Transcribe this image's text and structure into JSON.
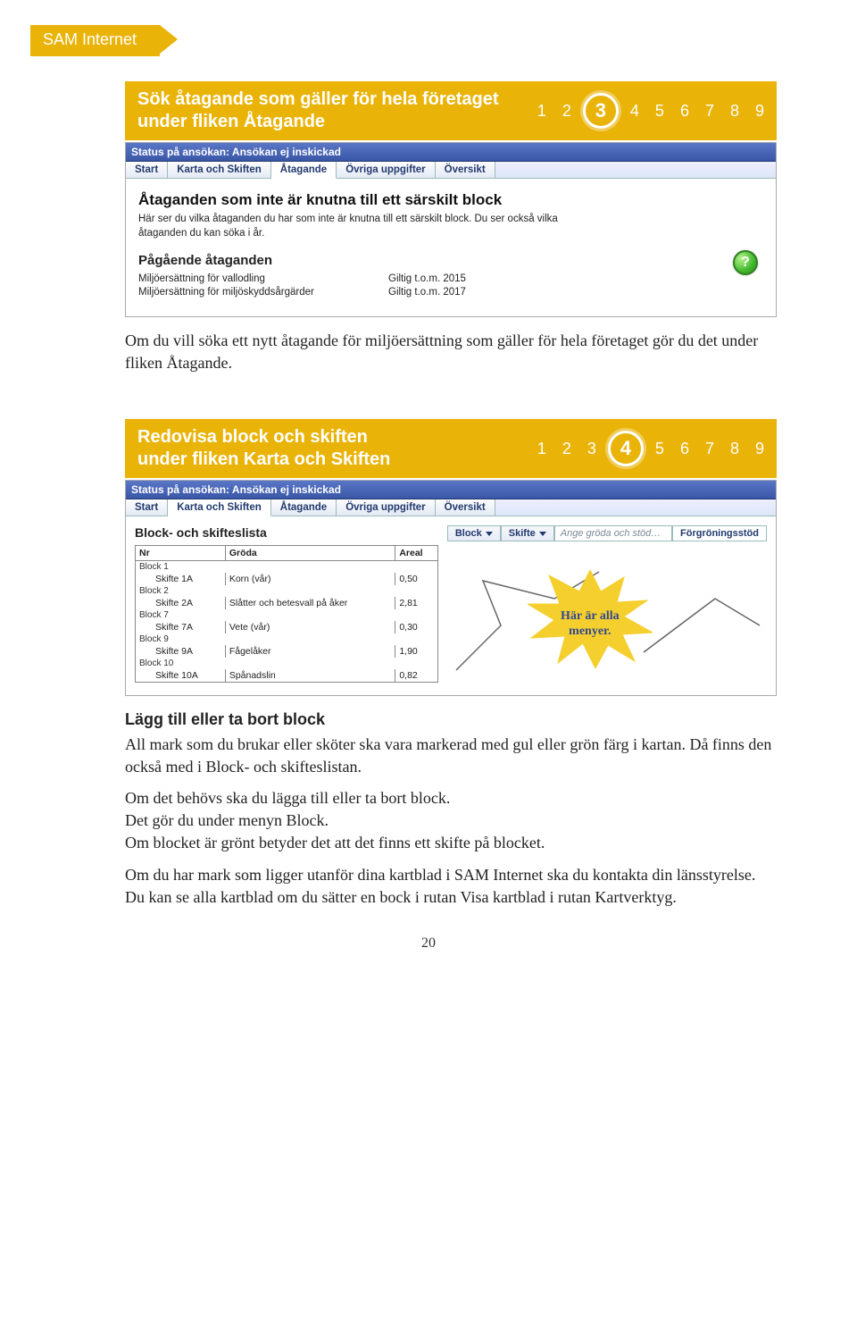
{
  "top_tab": "SAM Internet",
  "sections": [
    {
      "title_l1": "Sök åtagande som gäller för hela företaget",
      "title_l2": "under fliken Åtagande",
      "active_step": "3"
    },
    {
      "title_l1": "Redovisa block och skiften",
      "title_l2": "under fliken Karta och Skiften",
      "active_step": "4"
    }
  ],
  "steps": [
    "1",
    "2",
    "3",
    "4",
    "5",
    "6",
    "7",
    "8",
    "9"
  ],
  "window1": {
    "status": "Status på ansökan: Ansökan ej inskickad",
    "tabs": [
      "Start",
      "Karta och Skiften",
      "Åtagande",
      "Övriga uppgifter",
      "Översikt"
    ],
    "active_tab": "Åtagande",
    "heading": "Åtaganden som inte är knutna till ett särskilt block",
    "desc": "Här ser du vilka åtaganden du har som inte är knutna till ett särskilt block. Du ser också vilka åtaganden du kan söka i år.",
    "sub_heading": "Pågående åtaganden",
    "rows": [
      {
        "k": "Miljöersättning för vallodling",
        "v": "Giltig t.o.m. 2015"
      },
      {
        "k": "Miljöersättning för miljöskyddsårgärder",
        "v": "Giltig t.o.m. 2017"
      }
    ],
    "help_glyph": "?"
  },
  "para1": "Om du vill söka ett nytt åtagande för miljöersättning som gäller för hela företaget gör du det under fliken Åtagande.",
  "window2": {
    "status": "Status på ansökan: Ansökan ej inskickad",
    "tabs": [
      "Start",
      "Karta och Skiften",
      "Åtagande",
      "Övriga uppgifter",
      "Översikt"
    ],
    "active_tab": "Karta och Skiften",
    "list_title": "Block- och skifteslista",
    "cols": [
      "Nr",
      "Gröda",
      "Areal"
    ],
    "rows": [
      {
        "block": "Block 1",
        "nr": "Skifte 1A",
        "groda": "Korn (vår)",
        "areal": "0,50"
      },
      {
        "block": "Block 2",
        "nr": "Skifte 2A",
        "groda": "Slåtter och betesvall på åker",
        "areal": "2,81"
      },
      {
        "block": "Block 7",
        "nr": "Skifte 7A",
        "groda": "Vete (vår)",
        "areal": "0,30"
      },
      {
        "block": "Block 9",
        "nr": "Skifte 9A",
        "groda": "Fågelåker",
        "areal": "1,90"
      },
      {
        "block": "Block 10",
        "nr": "Skifte 10A",
        "groda": "Spånadslin",
        "areal": "0,82"
      }
    ],
    "toolbar": {
      "block": "Block",
      "skifte": "Skifte",
      "placeholder": "Ange gröda och stöd…",
      "right": "Förgröningsstöd"
    },
    "burst_l1": "Här är alla",
    "burst_l2": "menyer."
  },
  "para2": {
    "h": "Lägg till eller ta bort block",
    "p1": "All mark som du brukar eller sköter ska vara markerad med gul eller grön färg i kartan. Då finns den också med i Block- och skifteslistan.",
    "p2": "Om det behövs ska du lägga till eller ta bort block.",
    "p3": "Det gör du under menyn Block.",
    "p4": "Om blocket är grönt betyder det att det finns ett skifte på blocket.",
    "p5": "Om du har mark som ligger utanför dina kartblad i SAM Internet ska du kontakta din länsstyrelse.",
    "p6": "Du kan se alla kartblad om du sätter en bock i rutan Visa kartblad i rutan Kartverktyg."
  },
  "page_number": "20"
}
